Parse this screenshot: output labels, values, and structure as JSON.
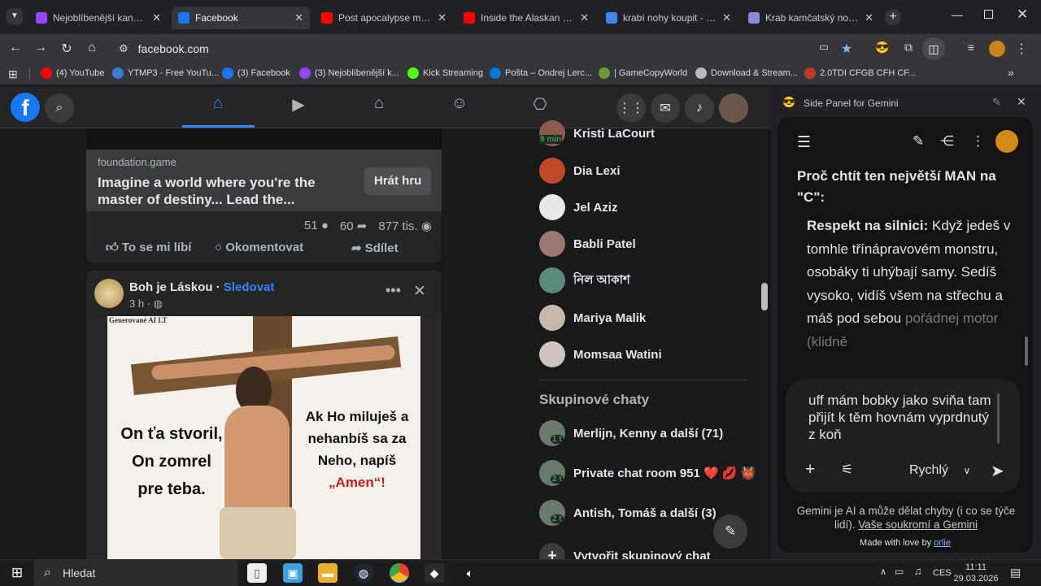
{
  "browser": {
    "tabs": [
      {
        "title": "Nejoblíbenější kanály - Twitch",
        "icon": "twitch-icon",
        "color": "#9146ff"
      },
      {
        "title": "Facebook",
        "icon": "facebook-icon",
        "color": "#1877f2"
      },
      {
        "title": "Post apocalypse music video",
        "icon": "youtube-icon",
        "color": "#ff0000"
      },
      {
        "title": "Inside the Alaskan King Crab",
        "icon": "youtube-icon",
        "color": "#ff0000"
      },
      {
        "title": "krabí nohy koupit - Hledat",
        "icon": "google-icon",
        "color": "#4285f4"
      },
      {
        "title": "Krab kamčatský nohy syrové",
        "icon": "crab-icon",
        "color": "#8a8ad8"
      }
    ],
    "url": "facebook.com",
    "bookmarks": [
      {
        "label": "(4) YouTube",
        "icon": "youtube-icon",
        "color": "#ff0000"
      },
      {
        "label": "YTMP3 - Free YouTu...",
        "icon": "ytmp3-icon",
        "color": "#3a7bd5"
      },
      {
        "label": "(3) Facebook",
        "icon": "facebook-icon",
        "color": "#1877f2"
      },
      {
        "label": "(3) Nejoblíbenější k...",
        "icon": "twitch-icon",
        "color": "#9146ff"
      },
      {
        "label": "Kick Streaming",
        "icon": "kick-icon",
        "color": "#53fc18"
      },
      {
        "label": "Pošta – Ondrej Lerc...",
        "icon": "mail-icon",
        "color": "#0078d4"
      },
      {
        "label": "| GameCopyWorld",
        "icon": "gcw-icon",
        "color": "#6a9a3a"
      },
      {
        "label": "Download & Stream...",
        "icon": "archive-icon",
        "color": "#bbbbbb"
      },
      {
        "label": "2.0TDI CFGB CFH CF...",
        "icon": "gear-icon",
        "color": "#c0392b"
      }
    ]
  },
  "feed": {
    "ad": {
      "domain": "foundation.game",
      "text": "Imagine a world where you're the master of destiny... Lead the...",
      "cta": "Hrát hru",
      "comments": "51",
      "shares": "60",
      "views": "877 tis.",
      "like": "To se mi líbí",
      "comment": "Okomentovat",
      "share": "Sdílet"
    },
    "post": {
      "author": "Boh je Láskou",
      "dot": "·",
      "follow": "Sledovat",
      "time": "3 h ·",
      "image_watermark": "Generované AI LT",
      "image_text_left": "On ťa stvoril, On zomrel pre teba.",
      "image_text_right_1": "Ak Ho miluješ a nehanbíš sa za Neho, napíš",
      "image_text_right_2": "„Amen“!"
    }
  },
  "contacts": [
    {
      "name": "Kristi LaCourt",
      "badge": "9 min",
      "color": "#8b5a4a"
    },
    {
      "name": "Dia Lexi",
      "color": "#c0482a"
    },
    {
      "name": "Jel Aziz",
      "color": "#e8e8e8"
    },
    {
      "name": "Babli Patel",
      "color": "#9a7a70"
    },
    {
      "name": "নিল আকাশ",
      "color": "#5a8a7a"
    },
    {
      "name": "Mariya Malik",
      "color": "#c8b8a8"
    },
    {
      "name": "Momsaa Watini",
      "color": "#d0c4c0"
    }
  ],
  "group_chats": {
    "title": "Skupinové chaty",
    "items": [
      {
        "name": "Merlijn, Kenny a další (71)",
        "badge": "1 t"
      },
      {
        "name": "Private chat room 951 ❤️ 💋 👹",
        "badge": "2 t"
      },
      {
        "name": "Antish, Tomáš a další (3)",
        "badge": "2 t"
      }
    ],
    "create": "Vytvořit skupinový chat"
  },
  "gemini": {
    "title": "Side Panel for Gemini",
    "heading": "Proč chtít ten největší MAN na \"C\":",
    "bullet_bold": "Respekt na silnici:",
    "bullet_text": "Když jedeš v tomhle třínápravovém monstru, osobáky ti uhýbají samy. Sedíš vysoko, vidíš všem na střechu a máš pod sebou",
    "bullet_fade": "pořádnej motor (klidně",
    "input_text": "uff mám bobky jako sviňa tam přijít k těm hovnám vyprdnutý z koň",
    "mode": "Rychlý",
    "disclaimer": "Gemini je AI a může dělat chyby (i co se týče lidí).",
    "privacy_link": "Vaše soukromí a Gemini",
    "made_by": "Made with love by",
    "made_by_link": "orlie"
  },
  "taskbar": {
    "search": "Hledat",
    "lang": "CES",
    "time": "11:11",
    "date": "29.03.2026"
  }
}
